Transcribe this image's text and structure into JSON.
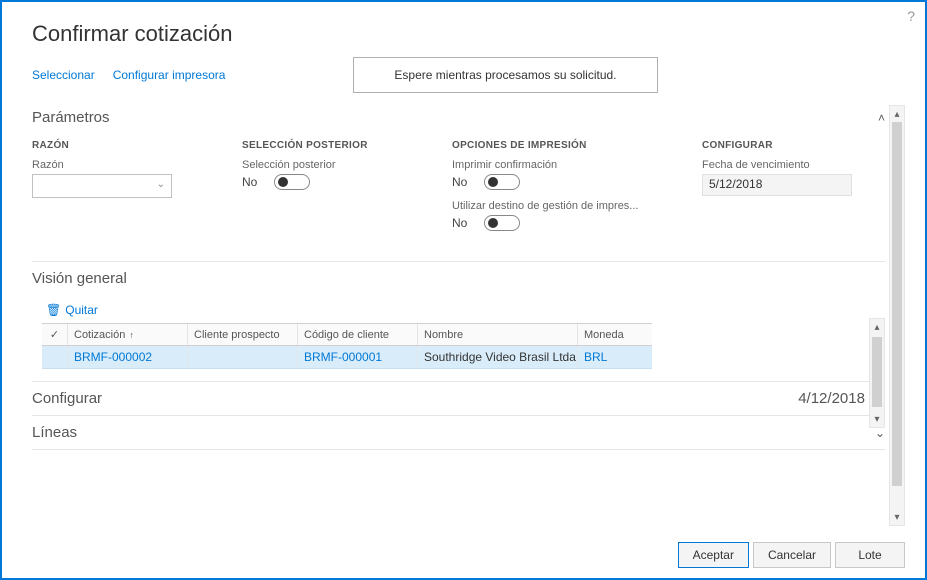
{
  "help_icon": "?",
  "title": "Confirmar cotización",
  "toolbar": {
    "select": "Seleccionar",
    "config_printer": "Configurar impresora"
  },
  "status_msg": "Espere mientras procesamos su solicitud.",
  "parameters": {
    "heading": "Parámetros",
    "reason": {
      "head": "RAZÓN",
      "label": "Razón"
    },
    "later_sel": {
      "head": "SELECCIÓN POSTERIOR",
      "label": "Selección posterior",
      "value": "No"
    },
    "print_opts": {
      "head": "OPCIONES DE IMPRESIÓN",
      "print_confirm_label": "Imprimir confirmación",
      "print_confirm_value": "No",
      "use_dest_label": "Utilizar destino de gestión de impres...",
      "use_dest_value": "No"
    },
    "configure": {
      "head": "CONFIGURAR",
      "due_date_label": "Fecha de vencimiento",
      "due_date_value": "5/12/2018"
    }
  },
  "overview": {
    "heading": "Visión general",
    "remove": "Quitar",
    "columns": {
      "quotation": "Cotización",
      "prospect": "Cliente prospecto",
      "customer_code": "Código de cliente",
      "name": "Nombre",
      "currency": "Moneda"
    },
    "rows": [
      {
        "quotation": "BRMF-000002",
        "prospect": "",
        "customer_code": "BRMF-000001",
        "name": "Southridge Video Brasil Ltda",
        "currency": "BRL"
      }
    ]
  },
  "configure_section": {
    "heading": "Configurar",
    "date": "4/12/2018"
  },
  "lines_section": {
    "heading": "Líneas"
  },
  "footer": {
    "ok": "Aceptar",
    "cancel": "Cancelar",
    "batch": "Lote"
  }
}
